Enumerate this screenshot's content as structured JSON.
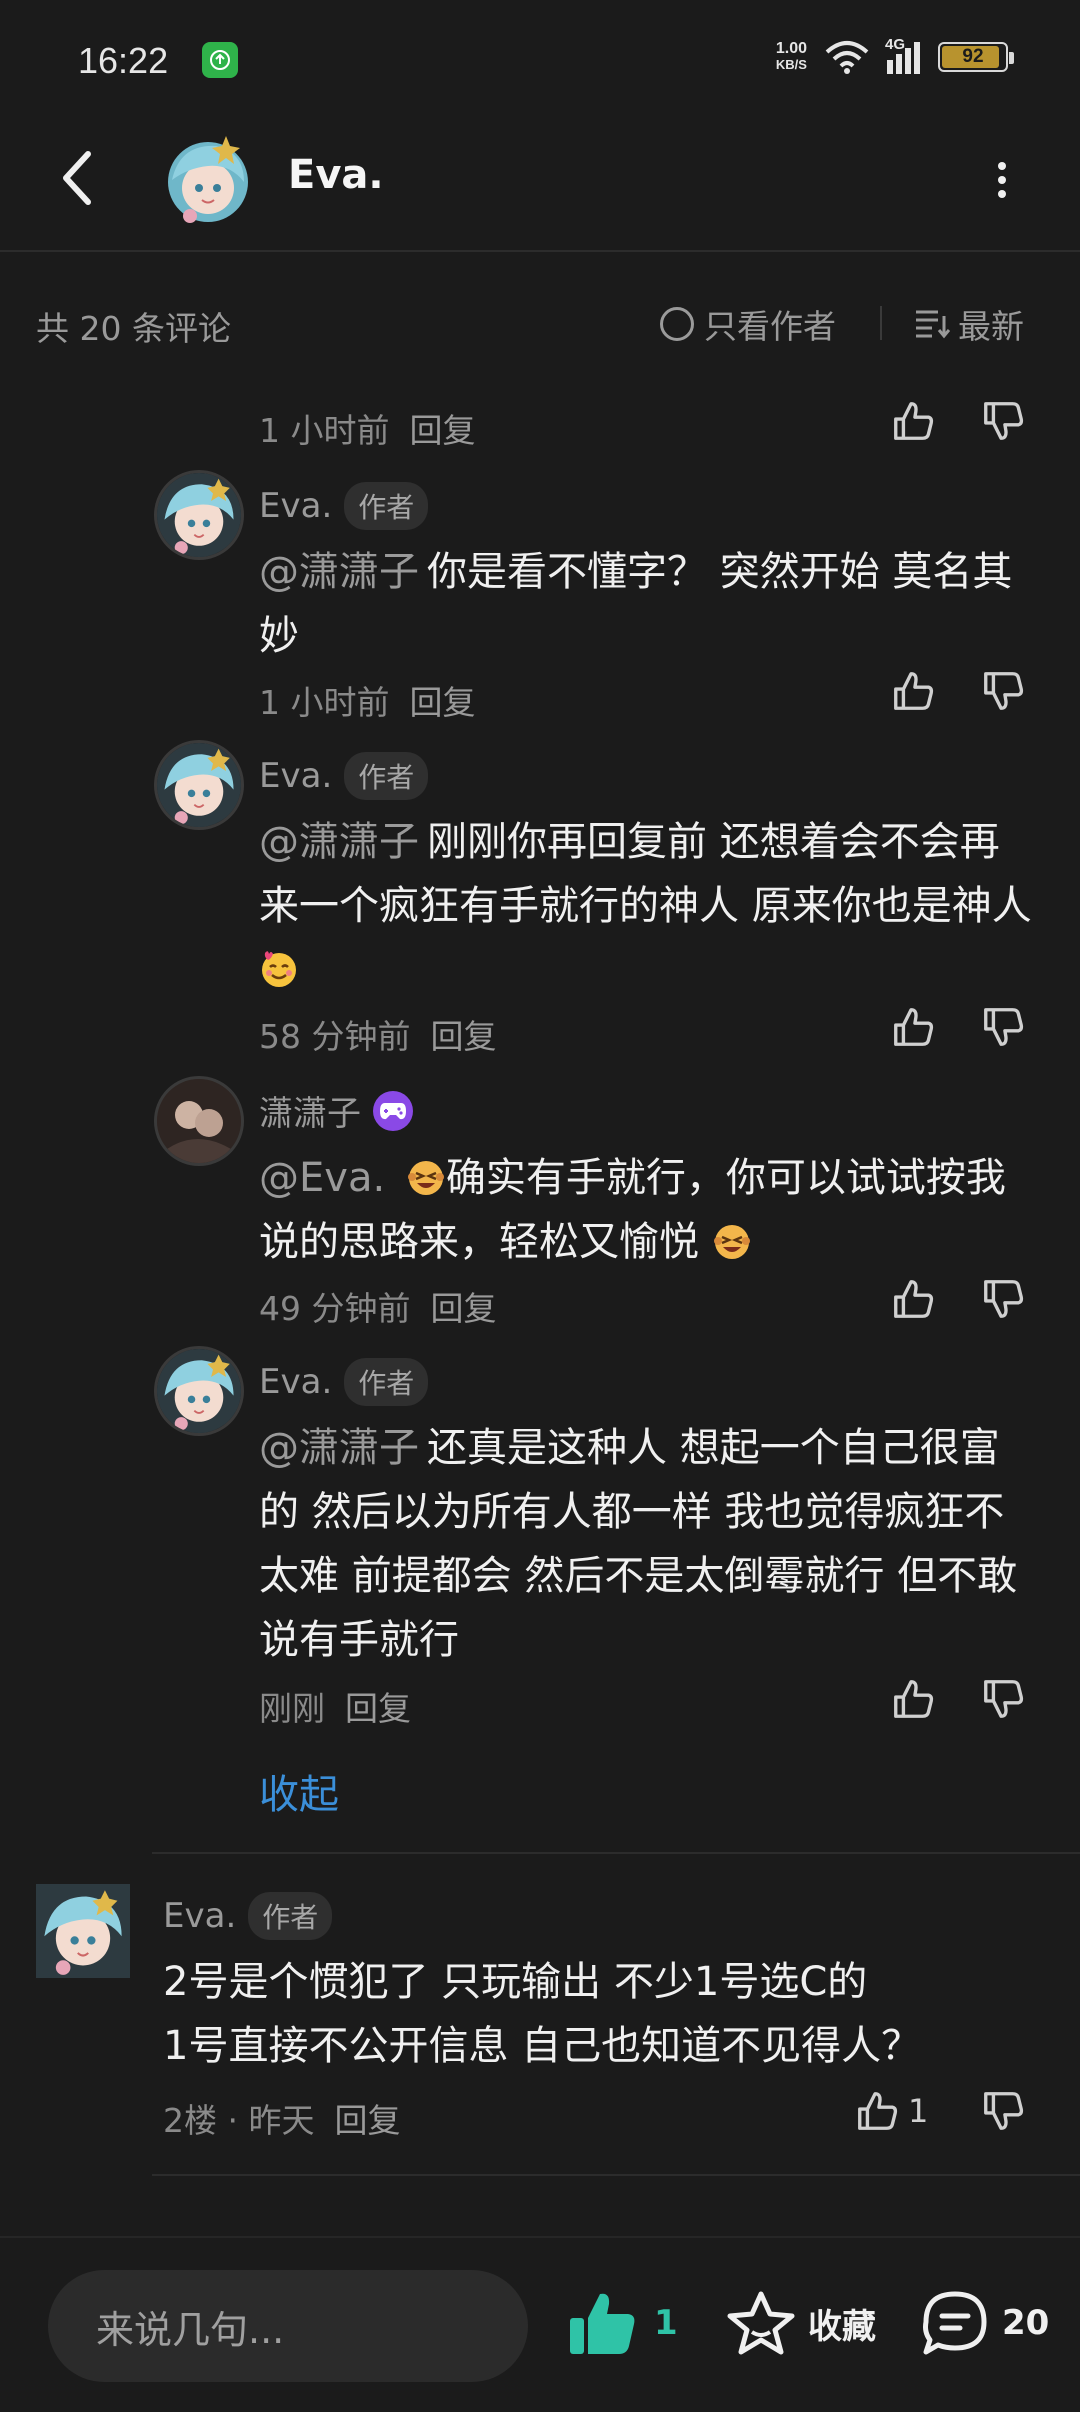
{
  "status": {
    "time": "16:22",
    "net_speed_value": "1.00",
    "net_speed_unit": "KB/S",
    "network": "4G",
    "battery": "92",
    "battery_level": 0.92
  },
  "header": {
    "title": "Eva."
  },
  "subbar": {
    "count": "共 20 条评论",
    "author_only": "只看作者",
    "latest": "最新"
  },
  "replies": [
    {
      "meta_time": "1 小时前",
      "reply": "回复"
    },
    {
      "name": "Eva.",
      "tag": "作者",
      "mention": "@潇潇子",
      "text": "你是看不懂字？ 突然开始 莫名其妙",
      "time": "1 小时前",
      "reply": "回复"
    },
    {
      "name": "Eva.",
      "tag": "作者",
      "mention": "@潇潇子",
      "text": "刚刚你再回复前 还想着会不会再来一个疯狂有手就行的神人 原来你也是神人",
      "time": "58 分钟前",
      "reply": "回复"
    },
    {
      "name": "潇潇子",
      "mention": "@Eva.",
      "text": "确实有手就行，你可以试试按我说的思路来，轻松又愉悦",
      "time": "49 分钟前",
      "reply": "回复"
    },
    {
      "name": "Eva.",
      "tag": "作者",
      "mention": "@潇潇子",
      "text": "还真是这种人 想起一个自己很富的 然后以为所有人都一样 我也觉得疯狂不太难 前提都会 然后不是太倒霉就行 但不敢说有手就行",
      "time": "刚刚",
      "reply": "回复"
    }
  ],
  "collapse": "收起",
  "floor2": {
    "name": "Eva.",
    "tag": "作者",
    "line1": "2号是个惯犯了 只玩输出 不少1号选C的",
    "line2": "1号直接不公开信息 自己也知道不见得人？",
    "floor": "2楼 · 昨天",
    "reply": "回复",
    "likes": "1"
  },
  "bottom": {
    "placeholder": "来说几句...",
    "likes": "1",
    "fav": "收藏",
    "comments": "20"
  },
  "colors": {
    "accent": "#3b8fd9",
    "like": "#2fc3a7",
    "badge": "#8a49e6"
  }
}
